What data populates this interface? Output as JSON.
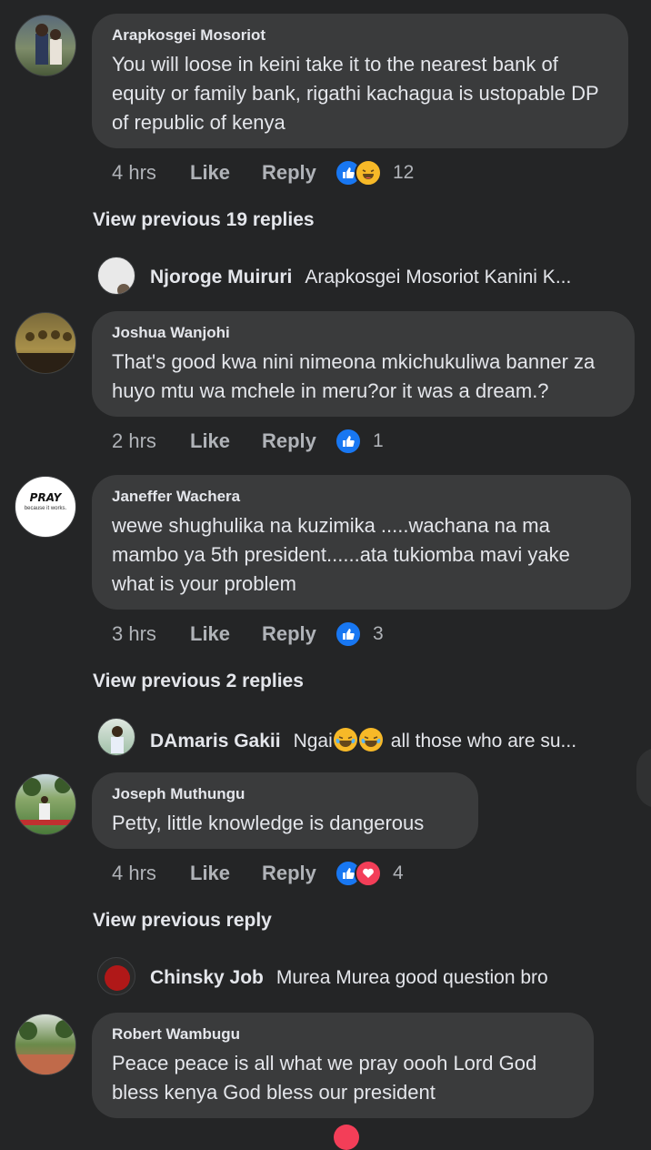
{
  "comments": [
    {
      "author": "Arapkosgei Mosoriot",
      "text": "You will loose in keini take it to the nearest bank of equity or family bank, rigathi kachagua is ustopable DP of republic of kenya",
      "time": "4 hrs",
      "like": "Like",
      "reply": "Reply",
      "reactions": [
        "like",
        "haha"
      ],
      "count": "12"
    },
    {
      "author": "Joshua Wanjohi",
      "text": "That's good kwa nini nimeona mkichukuliwa banner za huyo mtu wa mchele in meru?or it was a dream.?",
      "time": "2 hrs",
      "like": "Like",
      "reply": "Reply",
      "reactions": [
        "like"
      ],
      "count": "1"
    },
    {
      "author": "Janeffer Wachera",
      "text": "wewe shughulika na kuzimika .....wachana na ma mambo ya 5th president......ata tukiomba mavi yake what is your problem",
      "time": "3 hrs",
      "like": "Like",
      "reply": "Reply",
      "reactions": [
        "like"
      ],
      "count": "3",
      "avatar_text": "PRAY",
      "avatar_subtext": "because it works."
    },
    {
      "author": "Joseph Muthungu",
      "text": "Petty, little knowledge is dangerous",
      "time": "4 hrs",
      "like": "Like",
      "reply": "Reply",
      "reactions": [
        "like",
        "love"
      ],
      "count": "4"
    },
    {
      "author": "Robert Wambugu",
      "text": "Peace peace is all what we pray oooh Lord God bless kenya God bless our president"
    }
  ],
  "view_previous": [
    "View previous 19 replies",
    "View previous 2 replies",
    "View previous reply"
  ],
  "replies": [
    {
      "author": "Njoroge Muiruri",
      "text": "Arapkosgei Mosoriot Kanini K..."
    },
    {
      "author": "DAmaris Gakii",
      "text_before": "Ngai",
      "text_after": "all those who are su..."
    },
    {
      "author": "Chinsky Job",
      "text": "Murea Murea good question bro"
    }
  ],
  "colors": {
    "background": "#242526",
    "bubble": "#3a3b3c",
    "like_blue": "#1877f2",
    "haha_yellow": "#f7b928",
    "love_red": "#f33e58"
  },
  "icons": [
    "thumbs-up-icon",
    "laughing-emoji-icon",
    "heart-icon",
    "tears-of-joy-emoji-icon"
  ]
}
